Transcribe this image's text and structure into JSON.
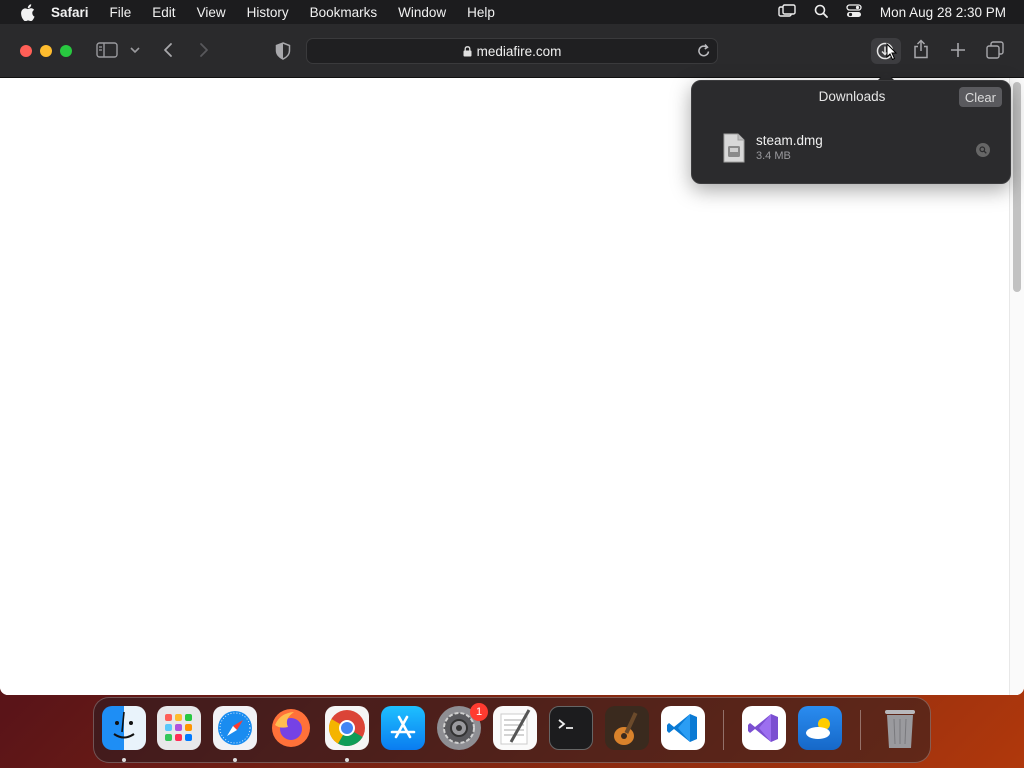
{
  "menubar": {
    "app_name": "Safari",
    "items": [
      "File",
      "Edit",
      "View",
      "History",
      "Bookmarks",
      "Window",
      "Help"
    ],
    "clock": "Mon Aug 28  2:30 PM"
  },
  "toolbar": {
    "url": "mediafire.com"
  },
  "downloads": {
    "title": "Downloads",
    "clear_label": "Clear",
    "items": [
      {
        "name": "steam.dmg",
        "size": "3.4 MB"
      }
    ]
  },
  "dock": {
    "apps": [
      {
        "name": "finder",
        "running": true
      },
      {
        "name": "launchpad",
        "running": false
      },
      {
        "name": "safari",
        "running": true
      },
      {
        "name": "firefox",
        "running": false
      },
      {
        "name": "chrome",
        "running": true
      },
      {
        "name": "app-store",
        "running": false
      },
      {
        "name": "system-settings",
        "running": false,
        "badge": "1"
      },
      {
        "name": "textedit",
        "running": false
      },
      {
        "name": "terminal",
        "running": false
      },
      {
        "name": "garageband",
        "running": false
      },
      {
        "name": "vscode",
        "running": false
      },
      {
        "name": "visual-studio",
        "running": false
      },
      {
        "name": "weather",
        "running": false
      },
      {
        "name": "trash",
        "running": false
      }
    ]
  },
  "colors": {
    "menubar_bg": "#1c1c1e",
    "toolbar_bg": "#2a2a2c",
    "popover_bg": "#2b2b2d",
    "close": "#ff5f57",
    "minimize": "#febc2e",
    "zoom": "#28c840",
    "badge": "#ff3b30"
  }
}
